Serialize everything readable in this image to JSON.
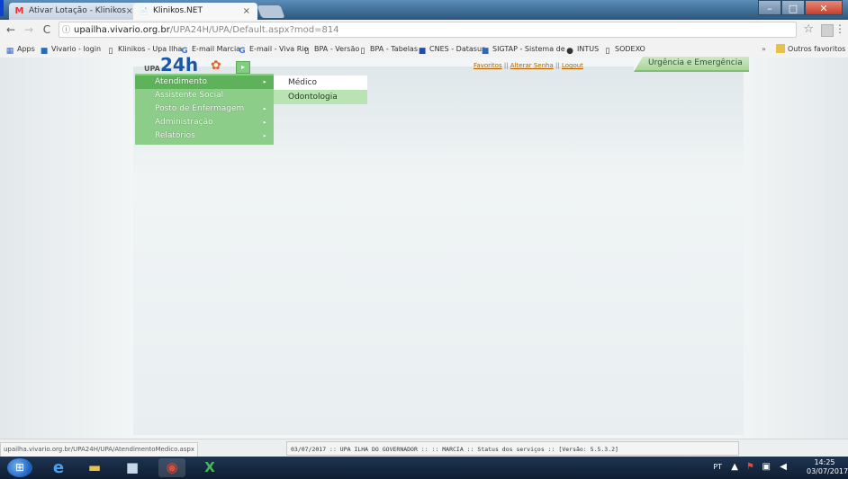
{
  "browser": {
    "tabs": [
      {
        "icon": "M",
        "title": "Ativar Lotação - Klinikos",
        "close": "×"
      },
      {
        "icon": "📄",
        "title": "Klinikos.NET",
        "close": "×"
      }
    ],
    "window_buttons": {
      "minimize": "–",
      "maximize": "□",
      "close": "✕"
    },
    "nav": {
      "back": "←",
      "forward": "→",
      "reload": "C"
    },
    "url_info": "ⓘ",
    "url_host": "upailha.vivario.org.br",
    "url_path": "/UPA24H/UPA/Default.aspx?mod=814",
    "star": "☆",
    "menu": "⋮",
    "bookmarks": [
      {
        "icon": "apps-icon",
        "glyph": "▦",
        "label": "Apps"
      },
      {
        "icon": "bookmark-icon",
        "glyph": "■",
        "label": "Vivario - login"
      },
      {
        "icon": "page-icon",
        "glyph": "▯",
        "label": "Klinikos - Upa Ilha"
      },
      {
        "icon": "google-icon",
        "glyph": "G",
        "label": "E-mail Marcia"
      },
      {
        "icon": "google-icon",
        "glyph": "G",
        "label": "E-mail - Viva Rio"
      },
      {
        "icon": "page-icon",
        "glyph": "▯",
        "label": "BPA - Versão"
      },
      {
        "icon": "page-icon",
        "glyph": "▯",
        "label": "BPA - Tabelas"
      },
      {
        "icon": "datasus-icon",
        "glyph": "■",
        "label": "CNES - Datasus"
      },
      {
        "icon": "sigtap-icon",
        "glyph": "■",
        "label": "SIGTAP - Sistema de"
      },
      {
        "icon": "intus-icon",
        "glyph": "●",
        "label": "INTUS"
      },
      {
        "icon": "page-icon",
        "glyph": "▯",
        "label": "SODEXO"
      }
    ],
    "bookmarks_overflow": "»",
    "other_bookmarks": "Outros favoritos"
  },
  "app": {
    "logo_upa": "UPA",
    "logo_24h": "24h",
    "logo_flower": "✿",
    "logo_green": "▸",
    "top_links": [
      "Favoritos",
      "Alterar Senha",
      "Logout"
    ],
    "top_sep": "||",
    "section_title": "Urgência e Emergência",
    "menu": [
      {
        "label": "Atendimento",
        "arrow": "▸"
      },
      {
        "label": "Assistente Social",
        "arrow": ""
      },
      {
        "label": "Posto de Enfermagem",
        "arrow": "▸"
      },
      {
        "label": "Administração",
        "arrow": "▸"
      },
      {
        "label": "Relatórios",
        "arrow": "▸"
      }
    ],
    "submenu": [
      "Médico",
      "Odontologia"
    ]
  },
  "status": {
    "url_hint": "upailha.vivario.org.br/UPA24H/UPA/AtendimentoMedico.aspx",
    "line": "03/07/2017 :: UPA ILHA DO GOVERNADOR :: :: MARCIA :: Status dos serviços :: [Versão: 5.5.3.2]"
  },
  "taskbar": {
    "apps": [
      {
        "name": "ie-icon",
        "glyph": "e",
        "color": "#3a8de0"
      },
      {
        "name": "explorer-icon",
        "glyph": "▬",
        "color": "#e8c14a"
      },
      {
        "name": "media-icon",
        "glyph": "■",
        "color": "#c8d8e8"
      },
      {
        "name": "chrome-icon",
        "glyph": "◉",
        "color": "#e04a3a"
      },
      {
        "name": "excel-icon",
        "glyph": "X",
        "color": "#3a9a4a"
      }
    ],
    "start": "⊞",
    "lang": "PT",
    "tray": {
      "up": "▲",
      "flag": "⚑",
      "network": "▣",
      "volume": "◀"
    },
    "time": "14:25",
    "date": "03/07/2017"
  }
}
